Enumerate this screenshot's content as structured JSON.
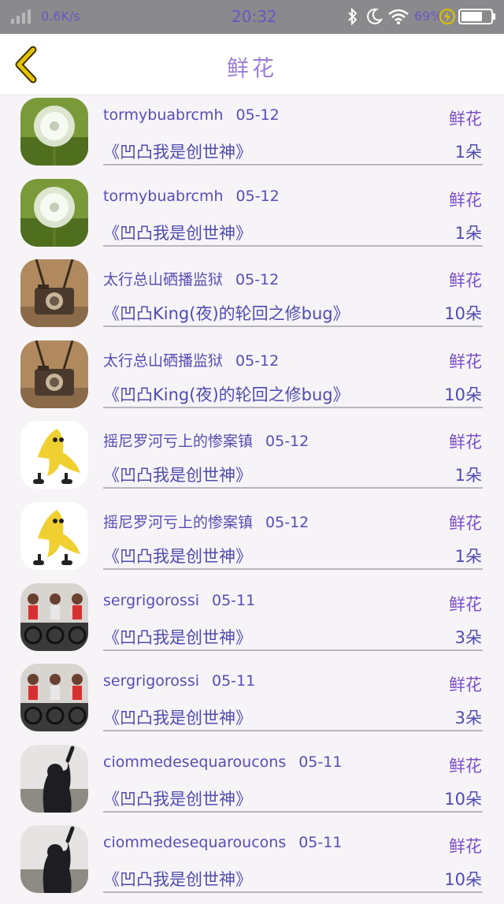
{
  "status_bar": {
    "speed": "0.6K/s",
    "time": "20:32",
    "battery": "69%"
  },
  "header": {
    "title": "鲜花"
  },
  "items": [
    {
      "user": "tormybuabrcmh",
      "date": "05-12",
      "title": "《凹凸我是创世神》",
      "gift": "鲜花",
      "count": "1朵",
      "avatar": "dandelion"
    },
    {
      "user": "tormybuabrcmh",
      "date": "05-12",
      "title": "《凹凸我是创世神》",
      "gift": "鲜花",
      "count": "1朵",
      "avatar": "dandelion"
    },
    {
      "user": "太行总山硒播监狱",
      "date": "05-12",
      "title": "《凹凸King(夜)的轮回之修bug》",
      "gift": "鲜花",
      "count": "10朵",
      "avatar": "camera"
    },
    {
      "user": "太行总山硒播监狱",
      "date": "05-12",
      "title": "《凹凸King(夜)的轮回之修bug》",
      "gift": "鲜花",
      "count": "10朵",
      "avatar": "camera"
    },
    {
      "user": "摇尼罗河亏上的惨案镇",
      "date": "05-12",
      "title": "《凹凸我是创世神》",
      "gift": "鲜花",
      "count": "1朵",
      "avatar": "banana"
    },
    {
      "user": "摇尼罗河亏上的惨案镇",
      "date": "05-12",
      "title": "《凹凸我是创世神》",
      "gift": "鲜花",
      "count": "1朵",
      "avatar": "banana"
    },
    {
      "user": "sergrigorossi",
      "date": "05-11",
      "title": "《凹凸我是创世神》",
      "gift": "鲜花",
      "count": "3朵",
      "avatar": "cycling"
    },
    {
      "user": "sergrigorossi",
      "date": "05-11",
      "title": "《凹凸我是创世神》",
      "gift": "鲜花",
      "count": "3朵",
      "avatar": "cycling"
    },
    {
      "user": "ciommedesequaroucons",
      "date": "05-11",
      "title": "《凹凸我是创世神》",
      "gift": "鲜花",
      "count": "10朵",
      "avatar": "girl"
    },
    {
      "user": "ciommedesequaroucons",
      "date": "05-11",
      "title": "《凹凸我是创世神》",
      "gift": "鲜花",
      "count": "10朵",
      "avatar": "girl"
    }
  ],
  "icons": {
    "back": "chevron-left-icon",
    "signal": "signal-icon",
    "bluetooth": "bluetooth-icon",
    "moon": "moon-icon",
    "wifi": "wifi-icon",
    "charge": "charging-icon",
    "battery": "battery-icon"
  },
  "colors": {
    "accent": "#9b7ed8",
    "text": "#5a4cb4",
    "status_bar": "#8a8a8c",
    "back_icon": "#d4b000"
  }
}
